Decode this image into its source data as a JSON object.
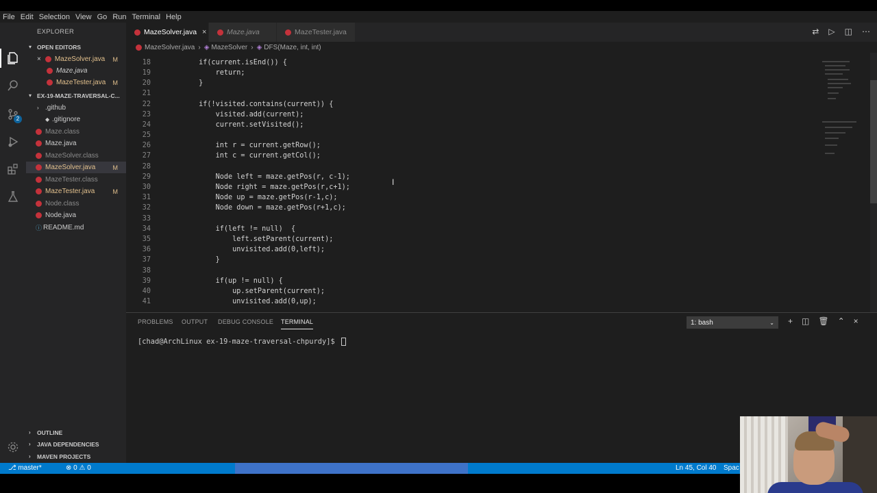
{
  "menu": [
    "File",
    "Edit",
    "Selection",
    "View",
    "Go",
    "Run",
    "Terminal",
    "Help"
  ],
  "activity": {
    "icons": [
      "files-icon",
      "search-icon",
      "source-control-icon",
      "run-debug-icon",
      "extensions-icon",
      "test-icon"
    ],
    "scm_badge": "2",
    "manage_icon": "gear-icon"
  },
  "sidebar": {
    "title": "EXPLORER",
    "open_editors_header": "OPEN EDITORS",
    "open_editors": [
      {
        "name": "MazeSolver.java",
        "status": "M"
      },
      {
        "name": "Maze.java",
        "status": ""
      },
      {
        "name": "MazeTester.java",
        "status": "M"
      }
    ],
    "project_header": "EX-19-MAZE-TRAVERSAL-C...",
    "files": [
      {
        "name": ".github",
        "status": ""
      },
      {
        "name": ".gitignore",
        "status": ""
      },
      {
        "name": "Maze.class",
        "status": ""
      },
      {
        "name": "Maze.java",
        "status": ""
      },
      {
        "name": "MazeSolver.class",
        "status": ""
      },
      {
        "name": "MazeSolver.java",
        "status": "M"
      },
      {
        "name": "MazeTester.class",
        "status": ""
      },
      {
        "name": "MazeTester.java",
        "status": "M"
      },
      {
        "name": "Node.class",
        "status": ""
      },
      {
        "name": "Node.java",
        "status": ""
      },
      {
        "name": "README.md",
        "status": ""
      }
    ],
    "outline_header": "OUTLINE",
    "java_deps_header": "JAVA DEPENDENCIES",
    "maven_header": "MAVEN PROJECTS"
  },
  "tabs": [
    {
      "label": "MazeSolver.java",
      "close": "×"
    },
    {
      "label": "Maze.java"
    },
    {
      "label": "MazeTester.java"
    }
  ],
  "breadcrumb": {
    "file": "MazeSolver.java",
    "class": "MazeSolver",
    "method": "DFS(Maze, int, int)"
  },
  "code": [
    {
      "n": "18",
      "t": "        if(current.isEnd()) {"
    },
    {
      "n": "19",
      "t": "            return;"
    },
    {
      "n": "20",
      "t": "        }"
    },
    {
      "n": "21",
      "t": ""
    },
    {
      "n": "22",
      "t": "        if(!visited.contains(current)) {"
    },
    {
      "n": "23",
      "t": "            visited.add(current);"
    },
    {
      "n": "24",
      "t": "            current.setVisited();"
    },
    {
      "n": "25",
      "t": ""
    },
    {
      "n": "26",
      "t": "            int r = current.getRow();"
    },
    {
      "n": "27",
      "t": "            int c = current.getCol();"
    },
    {
      "n": "28",
      "t": ""
    },
    {
      "n": "29",
      "t": "            Node left = maze.getPos(r, c-1);"
    },
    {
      "n": "30",
      "t": "            Node right = maze.getPos(r,c+1);"
    },
    {
      "n": "31",
      "t": "            Node up = maze.getPos(r-1,c);"
    },
    {
      "n": "32",
      "t": "            Node down = maze.getPos(r+1,c);"
    },
    {
      "n": "33",
      "t": ""
    },
    {
      "n": "34",
      "t": "            if(left != null)  {"
    },
    {
      "n": "35",
      "t": "                left.setParent(current);"
    },
    {
      "n": "36",
      "t": "                unvisited.add(0,left);"
    },
    {
      "n": "37",
      "t": "            }"
    },
    {
      "n": "38",
      "t": ""
    },
    {
      "n": "39",
      "t": "            if(up != null) {"
    },
    {
      "n": "40",
      "t": "                up.setParent(current);"
    },
    {
      "n": "41",
      "t": "                unvisited.add(0,up);"
    }
  ],
  "panel": {
    "tabs": [
      "PROBLEMS",
      "OUTPUT",
      "DEBUG CONSOLE",
      "TERMINAL"
    ],
    "active_tab": "TERMINAL",
    "terminal_select": "1: bash",
    "prompt": "[chad@ArchLinux ex-19-maze-traversal-chpurdy]$ "
  },
  "status": {
    "branch": "master*",
    "errors": "0",
    "warnings": "0",
    "position": "Ln 45, Col 40",
    "spaces": "Spac"
  },
  "colors": {
    "accent": "#007acc",
    "modified": "#e2c08d",
    "java_icon": "#c4323b"
  }
}
